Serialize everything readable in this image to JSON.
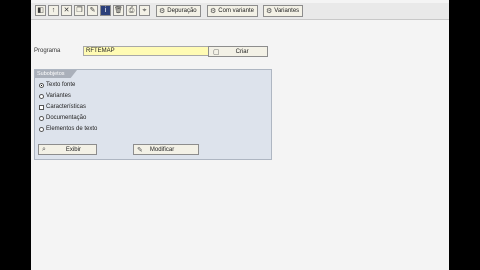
{
  "toolbar": {
    "icons": [
      "back-icon",
      "exit-icon",
      "cancel-icon",
      "copy-icon",
      "info-icon",
      "delete-icon",
      "print-icon",
      "where-used-icon"
    ],
    "buttons": [
      {
        "icon": "debug-icon",
        "label": "Depuração"
      },
      {
        "icon": "variant-exec-icon",
        "label": "Com variante"
      },
      {
        "icon": "variants-icon",
        "label": "Variantes"
      }
    ]
  },
  "program": {
    "label": "Programa",
    "value": "RFTEMAP",
    "create_label": "Criar"
  },
  "subobjects": {
    "title": "Subobjetos",
    "options": [
      {
        "type": "radio",
        "label": "Texto fonte",
        "selected": true
      },
      {
        "type": "radio",
        "label": "Variantes",
        "selected": false
      },
      {
        "type": "checkbox",
        "label": "Características",
        "selected": false
      },
      {
        "type": "radio",
        "label": "Documentação",
        "selected": false
      },
      {
        "type": "radio",
        "label": "Elementos de texto",
        "selected": false
      }
    ],
    "display_label": "Exibir",
    "modify_label": "Modificar"
  }
}
